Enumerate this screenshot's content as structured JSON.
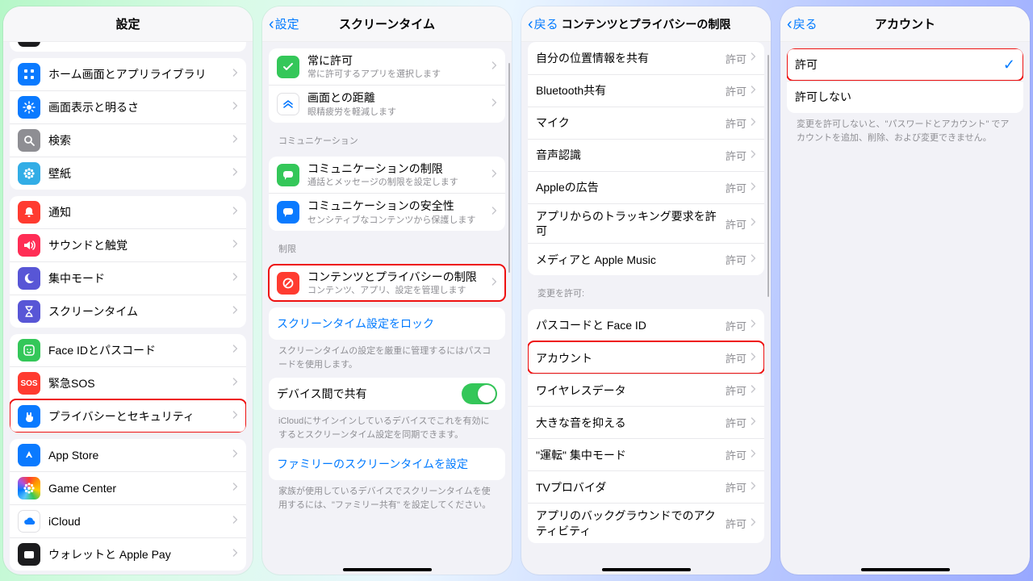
{
  "pane1": {
    "title": "設定",
    "groups": [
      {
        "rows": [
          {
            "icon": "home-icon",
            "bg": "bg-blue",
            "label": "ホーム画面とアプリライブラリ"
          },
          {
            "icon": "brightness-icon",
            "bg": "bg-blue",
            "label": "画面表示と明るさ"
          },
          {
            "icon": "search-icon",
            "bg": "bg-gray",
            "label": "検索"
          },
          {
            "icon": "wallpaper-icon",
            "bg": "bg-teal",
            "label": "壁紙"
          }
        ]
      },
      {
        "rows": [
          {
            "icon": "bell-icon",
            "bg": "bg-red",
            "label": "通知"
          },
          {
            "icon": "speaker-icon",
            "bg": "bg-pink",
            "label": "サウンドと触覚"
          },
          {
            "icon": "moon-icon",
            "bg": "bg-indigo",
            "label": "集中モード"
          },
          {
            "icon": "hourglass-icon",
            "bg": "bg-indigo",
            "label": "スクリーンタイム"
          }
        ]
      },
      {
        "rows": [
          {
            "icon": "faceid-icon",
            "bg": "bg-green",
            "label": "Face IDとパスコード"
          },
          {
            "icon": "sos-icon",
            "bg": "bg-sos",
            "label": "緊急SOS",
            "iconText": "SOS"
          },
          {
            "icon": "hand-icon",
            "bg": "bg-blue",
            "label": "プライバシーとセキュリティ",
            "highlight": true
          }
        ]
      },
      {
        "rows": [
          {
            "icon": "appstore-icon",
            "bg": "bg-blue",
            "label": "App Store"
          },
          {
            "icon": "gamecenter-icon",
            "bg": "multi",
            "label": "Game Center"
          },
          {
            "icon": "cloud-icon",
            "bg": "bg-white",
            "label": "iCloud",
            "iconColor": "#0a7aff"
          },
          {
            "icon": "wallet-icon",
            "bg": "bg-black",
            "label": "ウォレットと Apple Pay"
          }
        ]
      }
    ],
    "top_row_hidden": {
      "icon": "dots-icon",
      "bg": "bg-black",
      "label": ""
    }
  },
  "pane2": {
    "back": "設定",
    "title": "スクリーンタイム",
    "groups": [
      {
        "rows": [
          {
            "icon": "check-icon",
            "bg": "bg-green",
            "title": "常に許可",
            "sub": "常に許可するアプリを選択します"
          },
          {
            "icon": "distance-icon",
            "bg": "bg-white",
            "iconColor": "#0a7aff",
            "title": "画面との距離",
            "sub": "眼精疲労を軽減します"
          }
        ]
      },
      {
        "header": "コミュニケーション",
        "rows": [
          {
            "icon": "chat-icon",
            "bg": "bg-green",
            "title": "コミュニケーションの制限",
            "sub": "通話とメッセージの制限を設定します"
          },
          {
            "icon": "shield-chat-icon",
            "bg": "bg-blue",
            "title": "コミュニケーションの安全性",
            "sub": "センシティブなコンテンツから保護します"
          }
        ]
      },
      {
        "header": "制限",
        "highlight": true,
        "rows": [
          {
            "icon": "nosign-icon",
            "bg": "bg-red",
            "title": "コンテンツとプライバシーの制限",
            "sub": "コンテンツ、アプリ、設定を管理します"
          }
        ]
      },
      {
        "rows": [
          {
            "link": true,
            "title": "スクリーンタイム設定をロック"
          }
        ],
        "footer": "スクリーンタイムの設定を厳重に管理するにはパスコードを使用します。"
      },
      {
        "rows": [
          {
            "title": "デバイス間で共有",
            "toggle": true
          }
        ],
        "footer": "iCloudにサインインしているデバイスでこれを有効にするとスクリーンタイム設定を同期できます。"
      },
      {
        "rows": [
          {
            "link": true,
            "title": "ファミリーのスクリーンタイムを設定"
          }
        ],
        "footer": "家族が使用しているデバイスでスクリーンタイムを使用するには、\"ファミリー共有\" を設定してください。"
      }
    ]
  },
  "pane3": {
    "back": "戻る",
    "title": "コンテンツとプライバシーの制限",
    "groups": [
      {
        "rows": [
          {
            "title": "自分の位置情報を共有",
            "value": "許可"
          },
          {
            "title": "Bluetooth共有",
            "value": "許可"
          },
          {
            "title": "マイク",
            "value": "許可"
          },
          {
            "title": "音声認識",
            "value": "許可"
          },
          {
            "title": "Appleの広告",
            "value": "許可"
          },
          {
            "title": "アプリからのトラッキング要求を許可",
            "value": "許可"
          },
          {
            "title": "メディアと Apple Music",
            "value": "許可"
          }
        ]
      },
      {
        "header": "変更を許可:",
        "rows": [
          {
            "title": "パスコードと Face ID",
            "value": "許可"
          },
          {
            "title": "アカウント",
            "value": "許可",
            "highlight": true
          },
          {
            "title": "ワイヤレスデータ",
            "value": "許可"
          },
          {
            "title": "大きな音を抑える",
            "value": "許可"
          },
          {
            "title": "\"運転\" 集中モード",
            "value": "許可"
          },
          {
            "title": "TVプロバイダ",
            "value": "許可"
          },
          {
            "title": "アプリのバックグラウンドでのアクティビティ",
            "value": "許可"
          }
        ]
      }
    ]
  },
  "pane4": {
    "back": "戻る",
    "title": "アカウント",
    "groups": [
      {
        "rows": [
          {
            "title": "許可",
            "checked": true,
            "highlight": true
          },
          {
            "title": "許可しない"
          }
        ],
        "footer": "変更を許可しないと、\"パスワードとアカウント\" でアカウントを追加、削除、および変更できません。"
      }
    ]
  }
}
